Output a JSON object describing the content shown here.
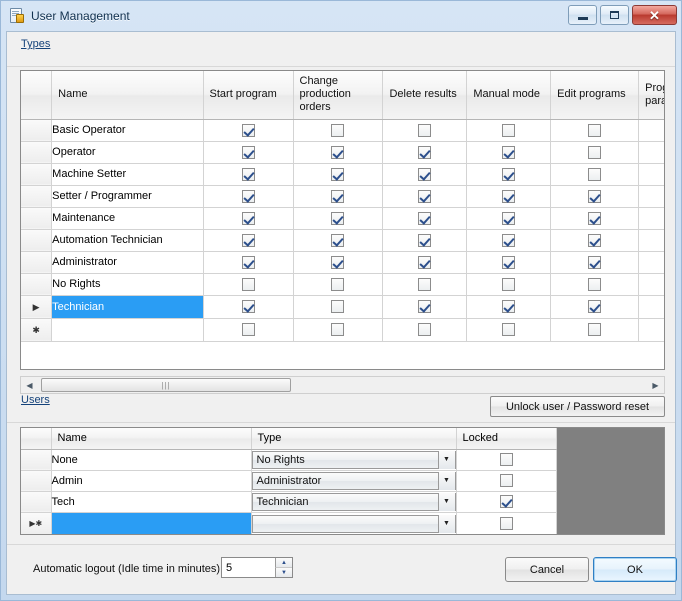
{
  "window": {
    "title": "User Management",
    "icon": "form-icon",
    "buttons": {
      "minimize": "minimize-icon",
      "maximize": "maximize-icon",
      "close": "✕"
    }
  },
  "types_section": {
    "label": "Types",
    "columns": [
      "Name",
      "Start program",
      "Change production orders",
      "Delete results",
      "Manual mode",
      "Edit programs",
      "Progr paran"
    ],
    "column_lines": [
      [
        "Name"
      ],
      [
        "Start program"
      ],
      [
        "Change",
        "production",
        "orders"
      ],
      [
        "Delete results"
      ],
      [
        "Manual mode"
      ],
      [
        "Edit programs"
      ],
      [
        "Progr",
        "paran"
      ]
    ],
    "rows": [
      {
        "marker": "",
        "name": "Basic Operator",
        "selected": false,
        "checks": [
          true,
          false,
          false,
          false,
          false
        ]
      },
      {
        "marker": "",
        "name": "Operator",
        "selected": false,
        "checks": [
          true,
          true,
          true,
          true,
          false
        ]
      },
      {
        "marker": "",
        "name": "Machine Setter",
        "selected": false,
        "checks": [
          true,
          true,
          true,
          true,
          false
        ]
      },
      {
        "marker": "",
        "name": "Setter / Programmer",
        "selected": false,
        "checks": [
          true,
          true,
          true,
          true,
          true
        ]
      },
      {
        "marker": "",
        "name": "Maintenance",
        "selected": false,
        "checks": [
          true,
          true,
          true,
          true,
          true
        ]
      },
      {
        "marker": "",
        "name": "Automation Technician",
        "selected": false,
        "checks": [
          true,
          true,
          true,
          true,
          true
        ]
      },
      {
        "marker": "",
        "name": "Administrator",
        "selected": false,
        "checks": [
          true,
          true,
          true,
          true,
          true
        ]
      },
      {
        "marker": "",
        "name": "No Rights",
        "selected": false,
        "checks": [
          false,
          false,
          false,
          false,
          false
        ]
      },
      {
        "marker": "▶",
        "name": "Technician",
        "selected": true,
        "checks": [
          true,
          false,
          true,
          true,
          true
        ]
      },
      {
        "marker": "✱",
        "name": "",
        "selected": false,
        "checks": [
          false,
          false,
          false,
          false,
          false
        ]
      }
    ],
    "scrollbar": {
      "left_arrow": "◀",
      "right_arrow": "▶",
      "grip": "|||"
    }
  },
  "users_section": {
    "label": "Users",
    "unlock_button": "Unlock user / Password reset",
    "columns": [
      "Name",
      "Type",
      "Locked"
    ],
    "rows": [
      {
        "marker": "",
        "name": "None",
        "type": "No Rights",
        "locked": false,
        "selected": false
      },
      {
        "marker": "",
        "name": "Admin",
        "type": "Administrator",
        "locked": false,
        "selected": false
      },
      {
        "marker": "",
        "name": "Tech",
        "type": "Technician",
        "locked": true,
        "selected": false
      },
      {
        "marker": "▶✱",
        "name": "",
        "type": "",
        "locked": false,
        "selected": true
      }
    ],
    "dropdown_arrow": "▼"
  },
  "footer": {
    "logout_label": "Automatic logout (Idle time in minutes):",
    "logout_value": "5",
    "spin_up": "▲",
    "spin_down": "▼",
    "cancel_label": "Cancel",
    "ok_label": "OK"
  },
  "colors": {
    "selection": "#2a9df4",
    "accent": "#14427a",
    "close_button": "#b9392e"
  }
}
